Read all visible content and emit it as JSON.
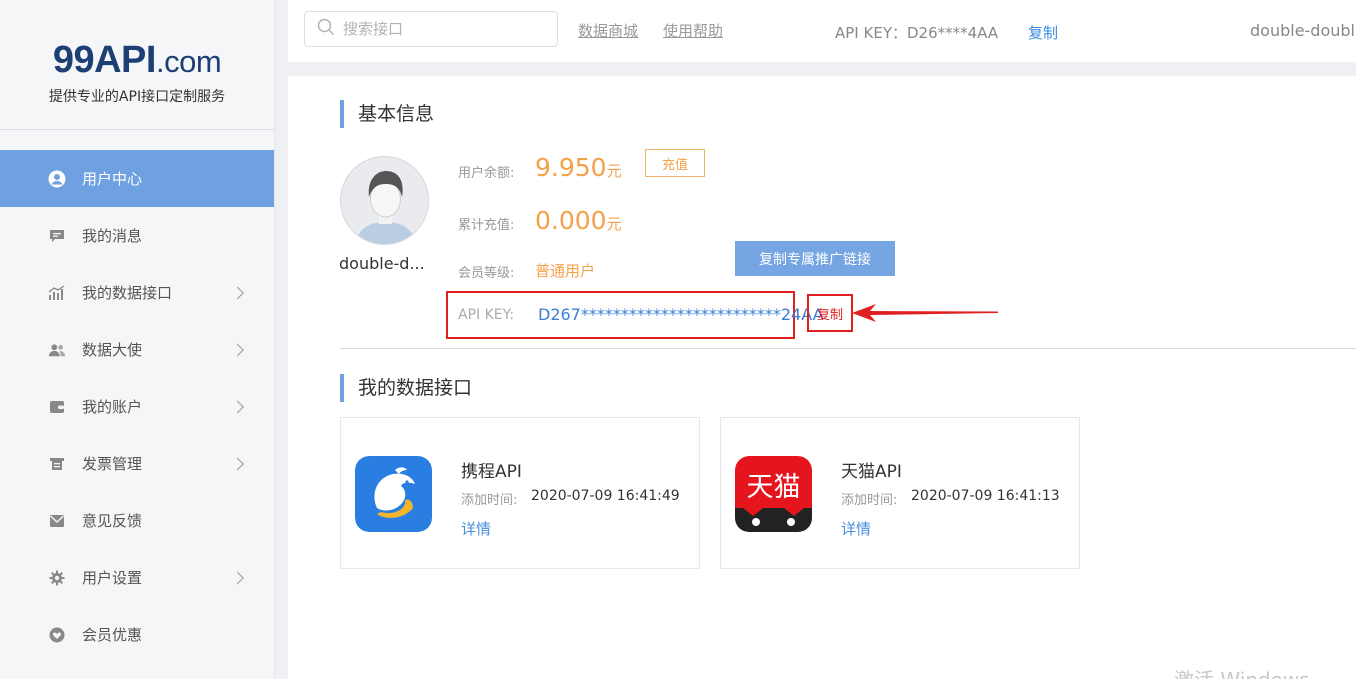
{
  "logo": {
    "main": "99API",
    "suffix": ".com",
    "tagline": "提供专业的API接口定制服务"
  },
  "sidebar": {
    "items": [
      {
        "label": "用户中心",
        "icon": "user-icon",
        "active": true,
        "has_arrow": false
      },
      {
        "label": "我的消息",
        "icon": "message-icon",
        "active": false,
        "has_arrow": false
      },
      {
        "label": "我的数据接口",
        "icon": "chart-icon",
        "active": false,
        "has_arrow": true
      },
      {
        "label": "数据大使",
        "icon": "people-icon",
        "active": false,
        "has_arrow": true
      },
      {
        "label": "我的账户",
        "icon": "wallet-icon",
        "active": false,
        "has_arrow": true
      },
      {
        "label": "发票管理",
        "icon": "invoice-icon",
        "active": false,
        "has_arrow": true
      },
      {
        "label": "意见反馈",
        "icon": "mail-icon",
        "active": false,
        "has_arrow": false
      },
      {
        "label": "用户设置",
        "icon": "gear-icon",
        "active": false,
        "has_arrow": true
      },
      {
        "label": "会员优惠",
        "icon": "heart-icon",
        "active": false,
        "has_arrow": false
      }
    ]
  },
  "topbar": {
    "search_placeholder": "搜索接口",
    "links": [
      "数据商城",
      "使用帮助"
    ],
    "api_key_text": "API KEY：D26****4AA",
    "copy_label": "复制",
    "username": "double-doubl"
  },
  "basic_info": {
    "title": "基本信息",
    "username": "double-d...",
    "balance_label": "用户余额:",
    "balance_value": "9.950",
    "balance_unit": "元",
    "recharge_label": "充值",
    "total_label": "累计充值:",
    "total_value": "0.000",
    "total_unit": "元",
    "level_label": "会员等级:",
    "level_value": "普通用户",
    "promo_button": "复制专属推广链接",
    "api_key_label": "API KEY:",
    "api_key_value": "D267*************************24AA",
    "copy_label": "复制"
  },
  "my_apis": {
    "title": "我的数据接口",
    "cards": [
      {
        "name": "携程API",
        "time_label": "添加时间:",
        "time": "2020-07-09 16:41:49",
        "detail": "详情",
        "icon": "ctrip-dolphin-icon"
      },
      {
        "name": "天猫API",
        "time_label": "添加时间:",
        "time": "2020-07-09 16:41:13",
        "detail": "详情",
        "icon": "tmall-icon",
        "icon_text": "天猫"
      }
    ]
  },
  "watermark": "激活 Windows",
  "colors": {
    "accent": "#6fa1e0",
    "orange": "#f5a04a",
    "highlight_red": "#e02020",
    "link_blue": "#3a8be0"
  }
}
